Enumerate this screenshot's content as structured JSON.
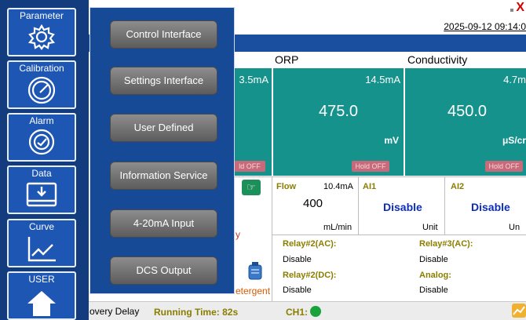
{
  "header": {
    "datetime": "2025-09-12 09:14:0",
    "close_glyph": "X"
  },
  "columns": {
    "orp_title": "ORP",
    "cond_title": "Conductivity"
  },
  "panels": {
    "left": {
      "ma": "3.5mA",
      "hold": "ld OFF"
    },
    "orp": {
      "ma": "14.5mA",
      "value": "475.0",
      "unit": "mV",
      "hold": "Hold OFF"
    },
    "cond": {
      "ma": "4.7m",
      "value": "450.0",
      "unit": "μS/cr",
      "hold": "Hold OFF"
    }
  },
  "flow": {
    "label": "Flow",
    "ma": "10.4mA",
    "value": "400",
    "unit": "mL/min"
  },
  "ai1": {
    "label": "AI1",
    "state": "Disable",
    "unit": "Unit"
  },
  "ai2": {
    "label": "AI2",
    "state": "Disable",
    "unit": "Un"
  },
  "relays": {
    "relay2ac_label": "Relay#2(AC):",
    "relay2ac_state": "Disable",
    "relay3ac_label": "Relay#3(AC):",
    "relay3ac_state": "Disable",
    "relay2dc_label": "Relay#2(DC):",
    "relay2dc_state": "Disable",
    "analog_label": "Analog:",
    "analog_state": "Disable"
  },
  "misc": {
    "detergent": "etergent",
    "y_mark": "y"
  },
  "status_bar": {
    "recovery": "overy Delay",
    "running_time": "Running Time: 82s",
    "ch1": "CH1:"
  },
  "sidebar": {
    "items": [
      {
        "label": "Parameter",
        "icon": "gear-icon"
      },
      {
        "label": "Calibration",
        "icon": "gauge-icon"
      },
      {
        "label": "Alarm",
        "icon": "alarm-icon"
      },
      {
        "label": "Data",
        "icon": "data-icon"
      },
      {
        "label": "Curve",
        "icon": "curve-icon"
      },
      {
        "label": "USER",
        "icon": "home-icon"
      }
    ]
  },
  "menu": {
    "items": [
      "Control Interface",
      "Settings Interface",
      "User Defined",
      "Information Service",
      "4-20mA Input",
      "DCS Output"
    ]
  },
  "colors": {
    "panel_teal": "#16928c",
    "sidebar_blue": "#1e56b3",
    "menu_blue": "#174a96",
    "status_green": "#1aa33a"
  }
}
